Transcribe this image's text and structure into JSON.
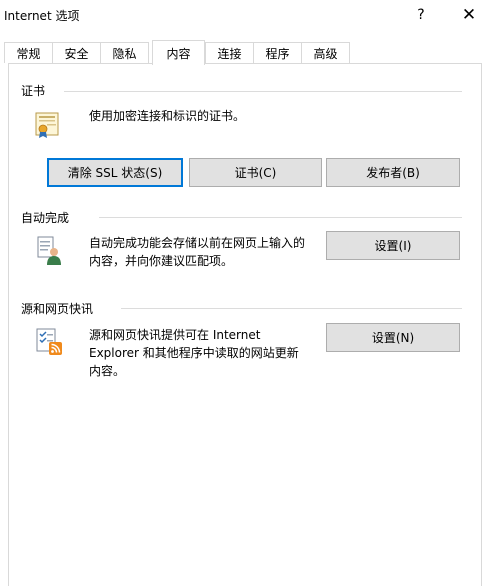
{
  "window": {
    "title": "Internet 选项",
    "help_label": "?",
    "close_label": "✕"
  },
  "tabs": [
    {
      "label": "常规"
    },
    {
      "label": "安全"
    },
    {
      "label": "隐私"
    },
    {
      "label": "内容",
      "active": true
    },
    {
      "label": "连接"
    },
    {
      "label": "程序"
    },
    {
      "label": "高级"
    }
  ],
  "certificates": {
    "group_label": "证书",
    "description": "使用加密连接和标识的证书。",
    "icon": "certificate-icon",
    "clear_ssl_label": "清除 SSL 状态(S)",
    "certificates_label": "证书(C)",
    "publishers_label": "发布者(B)"
  },
  "autocomplete": {
    "group_label": "自动完成",
    "description_line1": "自动完成功能会存储以前在网页上输入的",
    "description_line2": "内容，并向你建议匹配项。",
    "icon": "autocomplete-icon",
    "settings_label": "设置(I)"
  },
  "feeds": {
    "group_label": "源和网页快讯",
    "description_line1": "源和网页快讯提供可在 Internet",
    "description_line2": "Explorer 和其他程序中读取的网站更新",
    "description_line3": "内容。",
    "icon": "feeds-icon",
    "settings_label": "设置(N)"
  },
  "colors": {
    "accent": "#0078d7",
    "button_bg": "#e1e1e1",
    "button_border": "#adadad"
  }
}
